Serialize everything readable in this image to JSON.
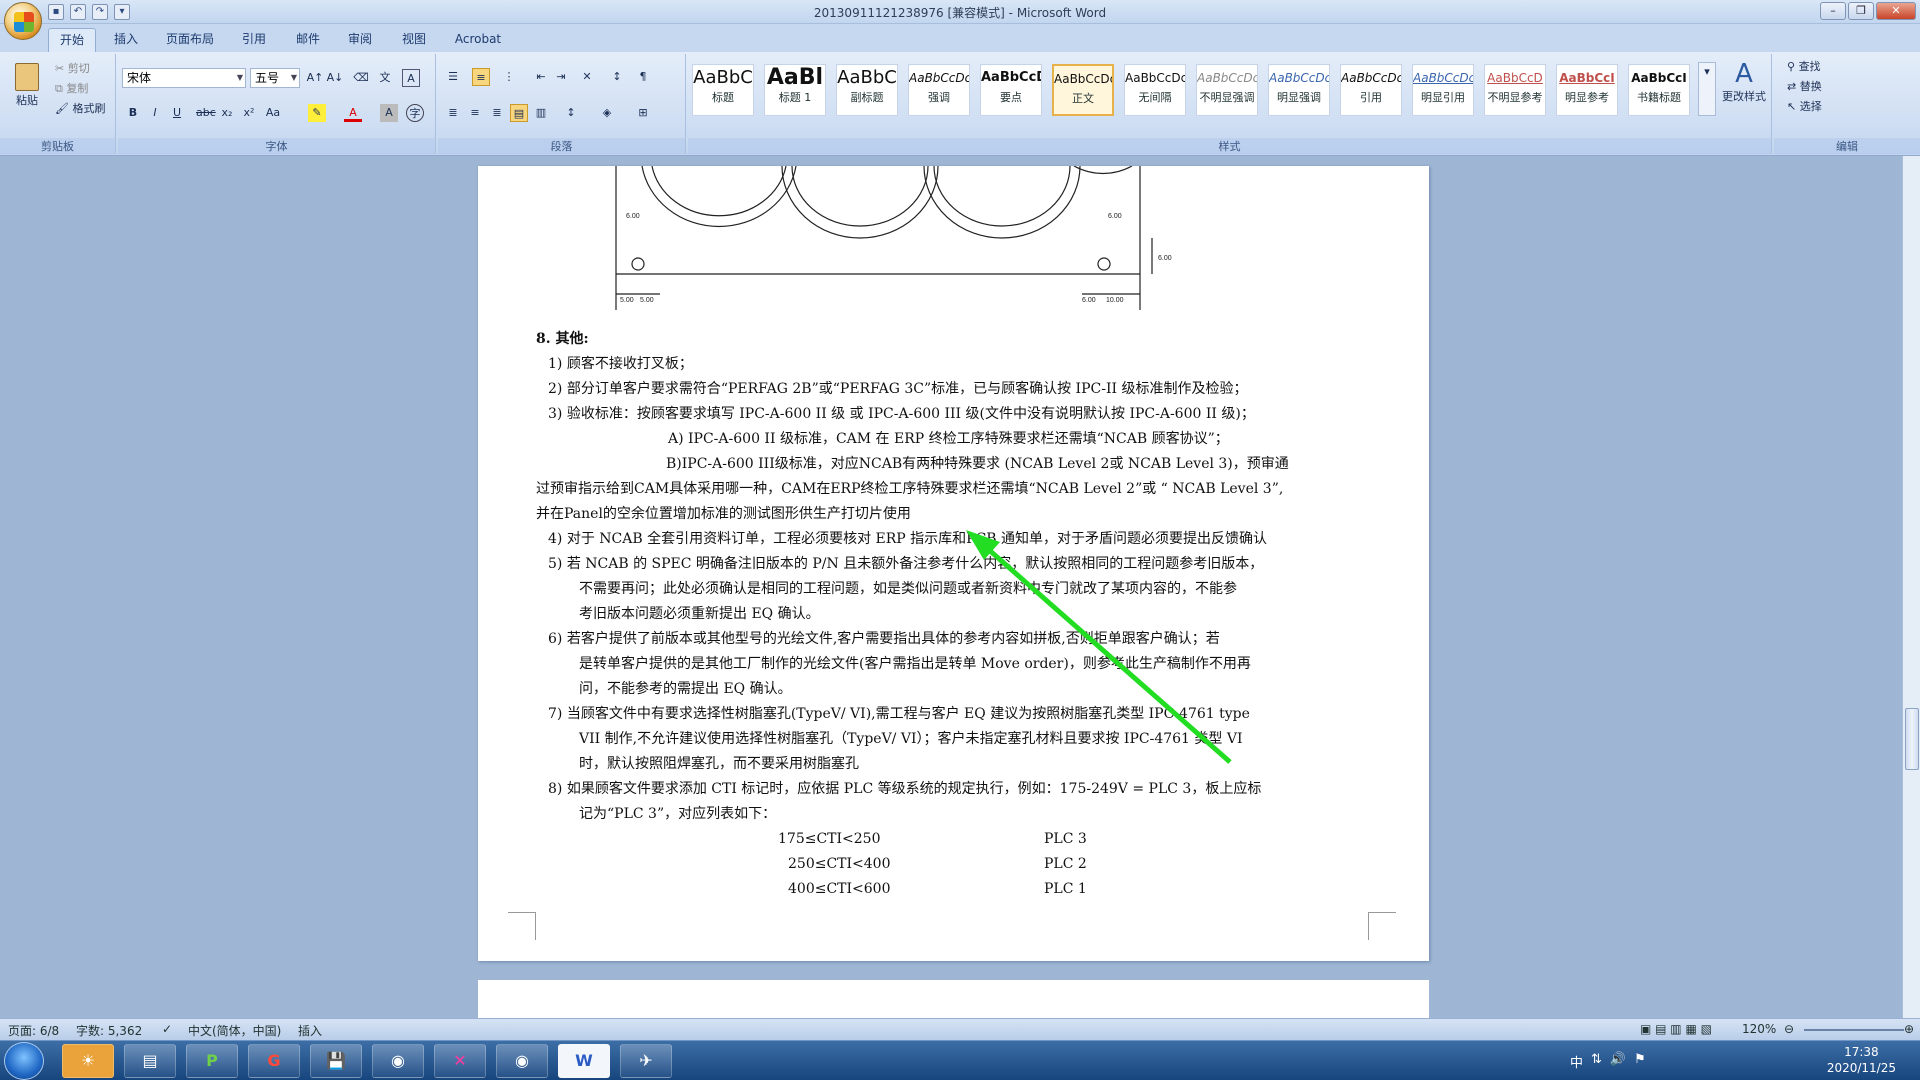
{
  "window": {
    "title": "20130911121238976 [兼容模式] - Microsoft Word"
  },
  "tabs": [
    "开始",
    "插入",
    "页面布局",
    "引用",
    "邮件",
    "审阅",
    "视图",
    "Acrobat"
  ],
  "clipboard": {
    "paste": "粘贴",
    "cut": "剪切",
    "copy": "复制",
    "format_painter": "格式刷",
    "label": "剪贴板"
  },
  "font": {
    "name": "宋体",
    "size": "五号",
    "label": "字体"
  },
  "paragraph": {
    "label": "段落"
  },
  "styles": {
    "label": "样式",
    "items": [
      {
        "preview": "AaBbC",
        "name": "标题"
      },
      {
        "preview": "AaBl",
        "name": "标题 1"
      },
      {
        "preview": "AaBbC",
        "name": "副标题"
      },
      {
        "preview": "AaBbCcDc",
        "name": "强调"
      },
      {
        "preview": "AaBbCcD",
        "name": "要点"
      },
      {
        "preview": "AaBbCcDc",
        "name": "正文"
      },
      {
        "preview": "AaBbCcDc",
        "name": "无间隔"
      },
      {
        "preview": "AaBbCcDc",
        "name": "不明显强调"
      },
      {
        "preview": "AaBbCcDc",
        "name": "明显强调"
      },
      {
        "preview": "AaBbCcDc",
        "name": "引用"
      },
      {
        "preview": "AaBbCcDc",
        "name": "明显引用"
      },
      {
        "preview": "AaBbCcD",
        "name": "不明显参考"
      },
      {
        "preview": "AaBbCcI",
        "name": "明显参考"
      },
      {
        "preview": "AaBbCcI",
        "name": "书籍标题"
      }
    ],
    "change": "更改样式"
  },
  "editing": {
    "find": "查找",
    "replace": "替换",
    "select": "选择",
    "label": "编辑"
  },
  "document": {
    "heading": "8.  其他:",
    "lines": [
      "1)  顾客不接收打叉板；",
      "2)  部分订单客户要求需符合“PERFAG 2B”或“PERFAG 3C”标准，已与顾客确认按 IPC-II 级标准制作及检验；",
      "3)  验收标准：按顾客要求填写 IPC-A-600 II 级 或 IPC-A-600 III 级(文件中没有说明默认按 IPC-A-600 II 级)；",
      "A)  IPC-A-600 II 级标准，CAM 在 ERP 终检工序特殊要求栏还需填“NCAB 顾客协议”；",
      "B)IPC-A-600 III级标准，对应NCAB有两种特殊要求 (NCAB Level 2或 NCAB Level 3)，预审通",
      "过预审指示给到CAM具体采用哪一种，CAM在ERP终检工序特殊要求栏还需填“NCAB Level 2”或 “ NCAB Level 3”,",
      "并在Panel的空余位置增加标准的测试图形供生产打切片使用",
      "4)  对于 NCAB 全套引用资料订单，工程必须要核对 ERP 指示库和PCB 通知单，对于矛盾问题必须要提出反馈确认",
      "5)  若 NCAB 的 SPEC 明确备注旧版本的 P/N 且未额外备注参考什么内容，默认按照相同的工程问题参考旧版本，",
      "不需要再问；此处必须确认是相同的工程问题，如是类似问题或者新资料中专门就改了某项内容的，不能参",
      "考旧版本问题必须重新提出 EQ 确认。",
      "6)  若客户提供了前版本或其他型号的光绘文件,客户需要指出具体的参考内容如拼板,否则拒单跟客户确认；若",
      "是转单客户提供的是其他工厂制作的光绘文件(客户需指出是转单 Move order)，则参考此生产稿制作不用再",
      "问，不能参考的需提出 EQ 确认。",
      "7)  当顾客文件中有要求选择性树脂塞孔(TypeV/ VI),需工程与客户 EQ 建议为按照树脂塞孔类型 IPC-4761 type",
      "VII  制作,不允许建议使用选择性树脂塞孔（TypeV/  VI）；客户未指定塞孔材料且要求按 IPC-4761 类型 VI",
      "时，默认按照阻焊塞孔，而不要采用树脂塞孔",
      "8)  如果顾客文件要求添加 CTI 标记时，应依据 PLC 等级系统的规定执行，例如：175-249V = PLC 3，板上应标",
      "记为“PLC 3”，对应列表如下："
    ],
    "cti_table": [
      {
        "range": "175≤CTI<250",
        "plc": "PLC 3"
      },
      {
        "range": "250≤CTI<400",
        "plc": "PLC 2"
      },
      {
        "range": "400≤CTI<600",
        "plc": "PLC 1"
      }
    ],
    "dims": [
      "6.00",
      "6.00",
      "5.00",
      "5.00",
      "6.00",
      "10.00",
      "6.00"
    ]
  },
  "status": {
    "page": "页面: 6/8",
    "words": "字数: 5,362",
    "lang": "中文(简体，中国)",
    "mode": "插入",
    "zoom": "120%"
  },
  "taskbar": {
    "time": "17:38",
    "date": "2020/11/25",
    "ime": "中"
  }
}
